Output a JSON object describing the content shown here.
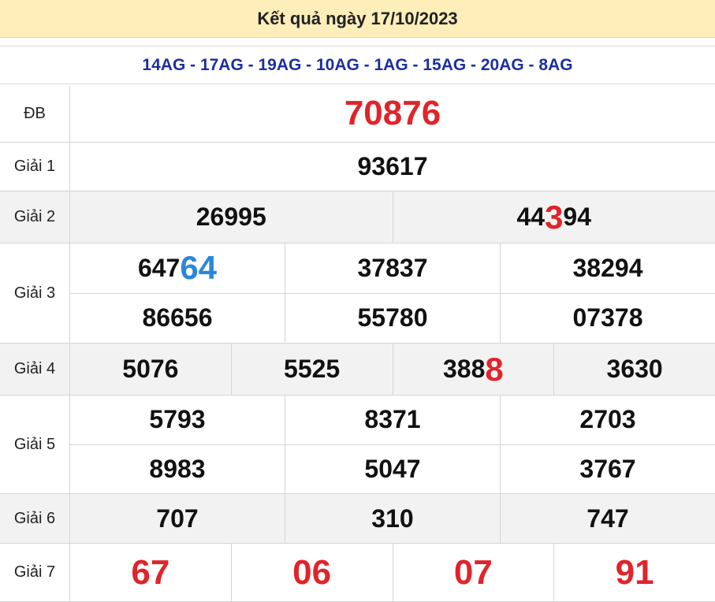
{
  "header": {
    "title": "Kết quả ngày 17/10/2023"
  },
  "codes": "14AG - 17AG - 19AG - 10AG - 1AG - 15AG - 20AG - 8AG",
  "colors": {
    "header_bg": "#fdeeba",
    "codes_text": "#1a2fa0",
    "highlight_red": "#e0242b",
    "highlight_blue": "#2a87d8",
    "row_gray": "#f2f2f2"
  },
  "prizes": {
    "db": {
      "label": "ĐB",
      "number": "70876"
    },
    "g1": {
      "label": "Giải 1",
      "number": "93617"
    },
    "g2": {
      "label": "Giải 2",
      "n1": "26995",
      "n2_pre": "44",
      "n2_hl": "3",
      "n2_post": "94"
    },
    "g3": {
      "label": "Giải 3",
      "n1_pre": "647",
      "n1_hl": "64",
      "n2": "37837",
      "n3": "38294",
      "n4": "86656",
      "n5": "55780",
      "n6": "07378"
    },
    "g4": {
      "label": "Giải 4",
      "n1": "5076",
      "n2": "5525",
      "n3_pre": "388",
      "n3_hl": "8",
      "n4": "3630"
    },
    "g5": {
      "label": "Giải 5",
      "n1": "5793",
      "n2": "8371",
      "n3": "2703",
      "n4": "8983",
      "n5": "5047",
      "n6": "3767"
    },
    "g6": {
      "label": "Giải 6",
      "n1": "707",
      "n2": "310",
      "n3": "747"
    },
    "g7": {
      "label": "Giải 7",
      "n1": "67",
      "n2": "06",
      "n3": "07",
      "n4": "91"
    }
  }
}
